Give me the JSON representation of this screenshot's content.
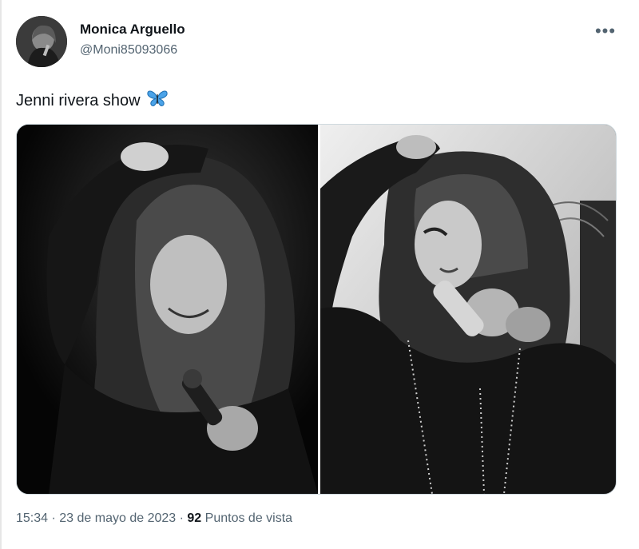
{
  "tweet": {
    "author": {
      "display_name": "Monica Arguello",
      "handle": "@Moni85093066"
    },
    "more_icon": "more-horizontal-icon",
    "text": "Jenni rivera show",
    "emoji": "butterfly",
    "media": [
      {
        "type": "photo",
        "tone": "black-and-white"
      },
      {
        "type": "photo",
        "tone": "black-and-white"
      }
    ],
    "time": "15:34",
    "separator": "·",
    "date": "23 de mayo de 2023",
    "views_count": "92",
    "views_label": "Puntos de vista"
  },
  "colors": {
    "text_primary": "#0f1419",
    "text_secondary": "#536471",
    "border": "#cfd9de",
    "butterfly_blue": "#4ba3e8"
  }
}
